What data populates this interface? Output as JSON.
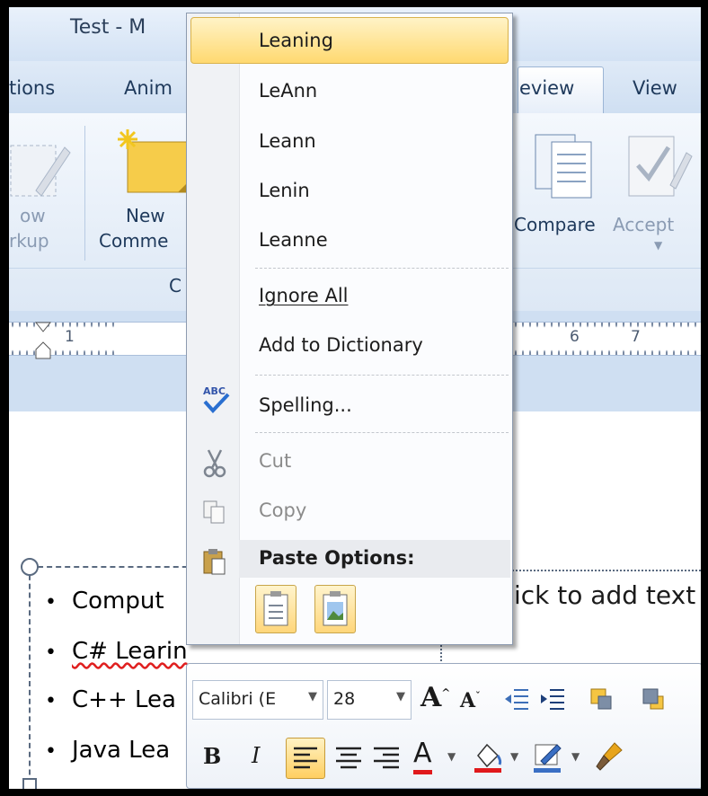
{
  "window": {
    "title": "Test - M"
  },
  "tabs": [
    "tions",
    "Anim",
    "eview",
    "View"
  ],
  "ribbon": {
    "show_markup_line1": "ow",
    "show_markup_line2": "rkup",
    "new_comment_line1": "New",
    "new_comment_line2": "Comme",
    "group_label": "C",
    "compare_label": "Compare",
    "accept_label": "Accept"
  },
  "ruler": {
    "marks": [
      "1",
      "6",
      "7"
    ]
  },
  "context_menu": {
    "suggestions": [
      "Leaning",
      "LeAnn",
      "Leann",
      "Lenin",
      "Leanne"
    ],
    "ignore_all": "Ignore All",
    "add_to_dictionary": "Add to Dictionary",
    "spelling": "Spelling...",
    "cut": "Cut",
    "copy": "Copy",
    "paste_options": "Paste Options:"
  },
  "slide": {
    "bullets": [
      "Comput",
      "C# Learin",
      "C++ Lea",
      "Java Lea"
    ],
    "placeholder_text": "ick to add text"
  },
  "mini_toolbar": {
    "font": "Calibri (E",
    "size": "28"
  }
}
